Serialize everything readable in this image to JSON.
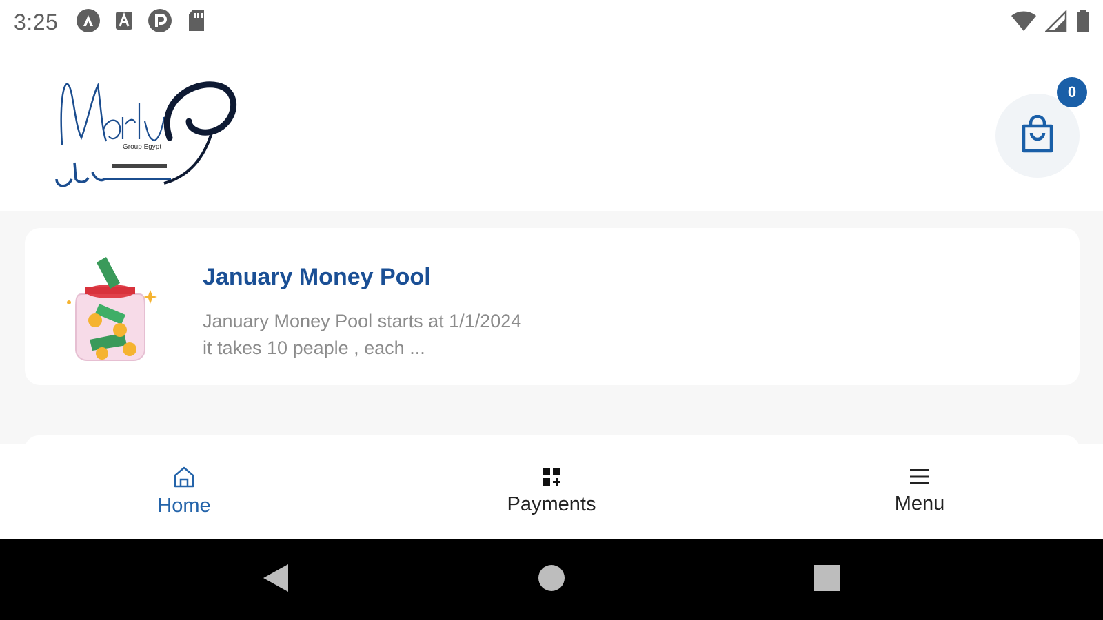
{
  "status_bar": {
    "time": "3:25",
    "left_icons": [
      "app-a-icon",
      "font-a-icon",
      "pay-icon",
      "sd-card-icon"
    ],
    "right_icons": [
      "wifi-icon",
      "cell-signal-icon",
      "battery-icon"
    ]
  },
  "header": {
    "logo_icon": "marly-logo-icon",
    "cart_icon": "shopping-bag-icon",
    "cart_count": "0"
  },
  "pools": [
    {
      "image_icon": "money-jar-icon",
      "title": "January Money Pool",
      "description_line1": "January Money Pool starts at 1/1/2024",
      "description_line2": "it takes 10 peaple , each ..."
    }
  ],
  "bottom_nav": {
    "items": [
      {
        "label": "Home",
        "icon": "home-icon",
        "active": true
      },
      {
        "label": "Payments",
        "icon": "grid-add-icon",
        "active": false
      },
      {
        "label": "Menu",
        "icon": "menu-icon",
        "active": false
      }
    ]
  },
  "system_nav": {
    "back": "back-icon",
    "home": "home-circle-icon",
    "recents": "recents-icon"
  },
  "colors": {
    "accent": "#1a4f95",
    "badge": "#1a5fa8",
    "active_nav": "#2464aa",
    "background": "#f7f7f7"
  }
}
